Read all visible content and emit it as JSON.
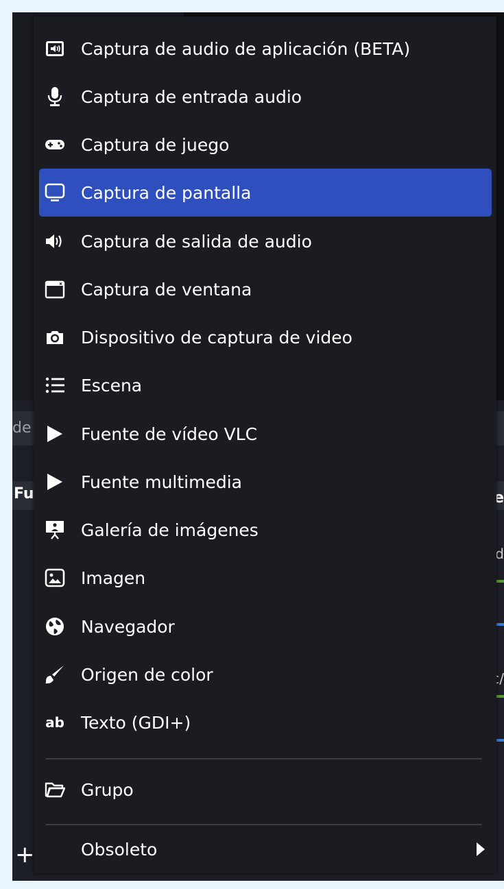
{
  "background": {
    "scene_filter_fragment": "de",
    "sources_title_fragment": "Fu",
    "mixer_title_fragment": "e",
    "mixer_fragment_1": "d",
    "mixer_fragment_2": "c/",
    "add_symbol": "+"
  },
  "colors": {
    "menu_bg": "#1a1c22",
    "highlight": "#2f4fbf",
    "text": "#ffffff"
  },
  "menu": {
    "items": [
      {
        "label": "Captura de audio de aplicación (BETA)",
        "icon": "app-audio-icon"
      },
      {
        "label": "Captura de entrada audio",
        "icon": "microphone-icon"
      },
      {
        "label": "Captura de juego",
        "icon": "gamepad-icon"
      },
      {
        "label": "Captura de pantalla",
        "icon": "monitor-icon",
        "active": true
      },
      {
        "label": "Captura de salida de audio",
        "icon": "speaker-icon"
      },
      {
        "label": "Captura de ventana",
        "icon": "window-icon"
      },
      {
        "label": "Dispositivo de captura de video",
        "icon": "camera-icon"
      },
      {
        "label": "Escena",
        "icon": "list-icon"
      },
      {
        "label": "Fuente de vídeo VLC",
        "icon": "play-icon"
      },
      {
        "label": "Fuente multimedia",
        "icon": "play-icon"
      },
      {
        "label": "Galería de imágenes",
        "icon": "slideshow-icon"
      },
      {
        "label": "Imagen",
        "icon": "image-icon"
      },
      {
        "label": "Navegador",
        "icon": "globe-icon"
      },
      {
        "label": "Origen de color",
        "icon": "brush-icon"
      },
      {
        "label": "Texto (GDI+)",
        "icon": "text-icon",
        "icon_text": "ab"
      }
    ],
    "group": {
      "label": "Grupo",
      "icon": "folder-icon"
    },
    "deprecated": {
      "label": "Obsoleto"
    }
  }
}
